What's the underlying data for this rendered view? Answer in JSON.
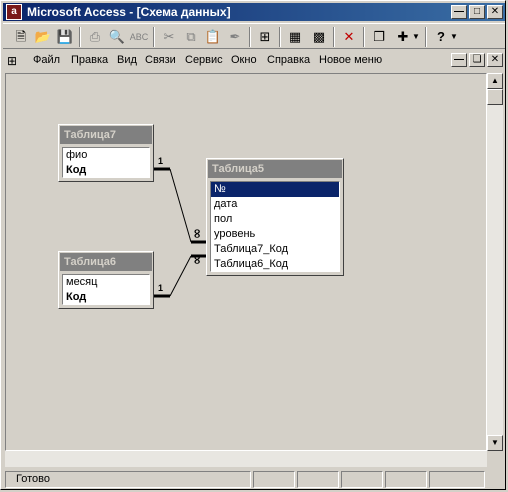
{
  "window": {
    "title": "Microsoft Access - [Схема данных]",
    "app_icon_letter": "a"
  },
  "toolbar": {
    "buttons": [
      "new-icon",
      "open-icon",
      "save-icon",
      "print-icon",
      "print-preview-icon",
      "spelling-icon",
      "cut-icon",
      "copy-icon",
      "paste-icon",
      "format-painter-icon",
      "show-table-icon",
      "show-direct-icon",
      "show-all-icon",
      "delete-icon",
      "new-object-icon",
      "help-icon"
    ]
  },
  "menu": {
    "items": [
      "Файл",
      "Правка",
      "Вид",
      "Связи",
      "Сервис",
      "Окно",
      "Справка",
      "Новое меню"
    ]
  },
  "tables": [
    {
      "title": "Таблица7",
      "fields": [
        "фио",
        "Код"
      ],
      "key": "Код"
    },
    {
      "title": "Таблица6",
      "fields": [
        "месяц",
        "Код"
      ],
      "key": "Код"
    },
    {
      "title": "Таблица5",
      "fields": [
        "№",
        "дата",
        "пол",
        "уровень",
        "Таблица7_Код",
        "Таблица6_Код"
      ],
      "selected": "№"
    }
  ],
  "relations": {
    "one_label": "1",
    "many_label": "∞"
  },
  "status": {
    "text": "Готово"
  }
}
